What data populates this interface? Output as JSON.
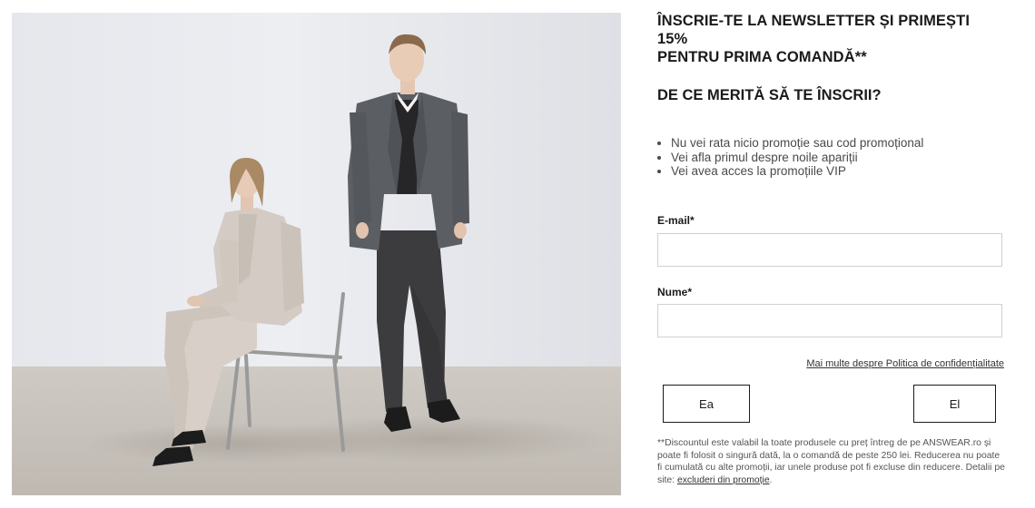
{
  "photo": {
    "alt": "Două modele în costume: o femeie așezată pe un scaun și un bărbat în picioare"
  },
  "newsletter": {
    "headline_line1": "Înscrie-te la newsletter și primești",
    "headline_line2": "15%",
    "headline_line3": "pentru prima comandă**",
    "subheading": "De ce merită să te înscrii?",
    "benefits": [
      "Nu vei rata nicio promoție sau cod promoțional",
      "Vei afla primul despre noile apariții",
      "Vei avea acces la promoțiile VIP"
    ],
    "email_label": "E-mail*",
    "email_value": "",
    "name_label": "Nume*",
    "name_value": "",
    "policy_link": "Mai multe despre Politica de confidențialitate",
    "choice_female": "Ea",
    "choice_male": "El",
    "disclaimer_text": "**Discountul este valabil la toate produsele cu preț întreg de pe ANSWEAR.ro și poate fi folosit o singură dată, la o comandă de peste 250 lei. Reducerea nu poate fi cumulată cu alte promoții, iar unele produse pot fi excluse din reducere. Detalii pe site: ",
    "disclaimer_link": "excluderi din promoție",
    "disclaimer_end": "."
  }
}
